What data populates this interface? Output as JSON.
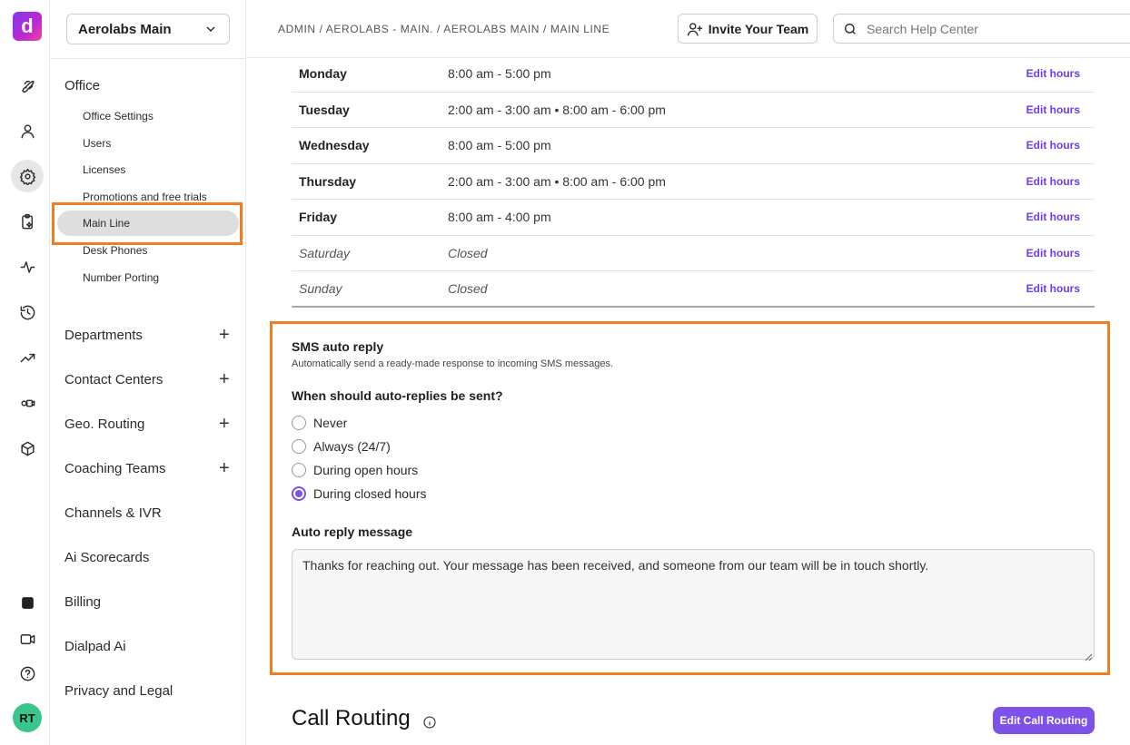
{
  "rail": {
    "logo": "d",
    "avatar": "RT",
    "icons": [
      "rocket-icon",
      "person-icon",
      "gear-icon",
      "clipboard-sparkle-icon",
      "activity-icon",
      "history-icon",
      "trend-icon",
      "video-settings-icon",
      "cube-icon",
      "dialpad-ai-icon",
      "video-icon",
      "help-icon"
    ]
  },
  "nav": {
    "org": "Aerolabs Main",
    "office": "Office",
    "sub_items": [
      "Office Settings",
      "Users",
      "Licenses",
      "Promotions and free trials",
      "Main Line",
      "Desk Phones",
      "Number Porting"
    ],
    "sections": [
      "Departments",
      "Contact Centers",
      "Geo. Routing",
      "Coaching Teams",
      "Channels & IVR",
      "Ai Scorecards",
      "Billing",
      "Dialpad Ai",
      "Privacy and Legal"
    ]
  },
  "header": {
    "breadcrumb": "ADMIN / AEROLABS - MAIN. / AEROLABS MAIN / MAIN LINE",
    "invite": "Invite Your Team",
    "search_placeholder": "Search Help Center"
  },
  "hours": [
    {
      "day": "Monday",
      "time": "8:00 am - 5:00 pm",
      "edit": "Edit hours"
    },
    {
      "day": "Tuesday",
      "time": "2:00 am - 3:00 am • 8:00 am - 6:00 pm",
      "edit": "Edit hours"
    },
    {
      "day": "Wednesday",
      "time": "8:00 am - 5:00 pm",
      "edit": "Edit hours"
    },
    {
      "day": "Thursday",
      "time": "2:00 am - 3:00 am • 8:00 am - 6:00 pm",
      "edit": "Edit hours"
    },
    {
      "day": "Friday",
      "time": "8:00 am - 4:00 pm",
      "edit": "Edit hours"
    },
    {
      "day": "Saturday",
      "time": "Closed",
      "edit": "Edit hours"
    },
    {
      "day": "Sunday",
      "time": "Closed",
      "edit": "Edit hours"
    }
  ],
  "sms": {
    "title": "SMS auto reply",
    "description": "Automatically send a ready-made response to incoming SMS messages.",
    "question": "When should auto-replies be sent?",
    "options": [
      "Never",
      "Always (24/7)",
      "During open hours",
      "During closed hours"
    ],
    "selected": "During closed hours",
    "message_label": "Auto reply message",
    "message": "Thanks for reaching out. Your message has been received, and someone from our team will be in touch shortly."
  },
  "call_routing": {
    "title": "Call Routing",
    "button": "Edit Call Routing"
  },
  "colors": {
    "accent": "#7c52e8",
    "highlight": "#f47c20"
  }
}
